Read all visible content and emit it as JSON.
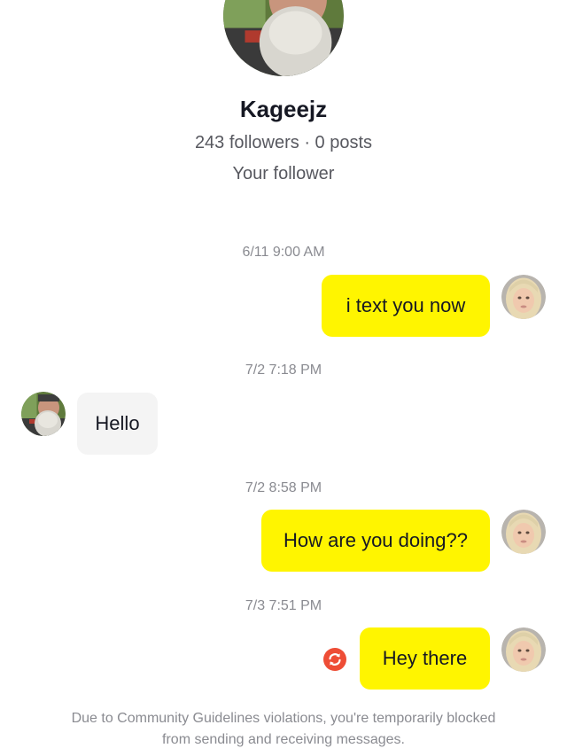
{
  "profile": {
    "name": "Kageejz",
    "stats": "243 followers · 0 posts",
    "relation": "Your follower",
    "avatar_icon": "profile-photo-bearded-man"
  },
  "messages": [
    {
      "timestamp": "6/11 9:00 AM",
      "direction": "outgoing",
      "text": "i text you now"
    },
    {
      "timestamp": "7/2 7:18 PM",
      "direction": "incoming",
      "text": "Hello"
    },
    {
      "timestamp": "7/2 8:58 PM",
      "direction": "outgoing",
      "text": "How are you doing??"
    },
    {
      "timestamp": "7/3 7:51 PM",
      "direction": "outgoing",
      "text": "Hey there",
      "status_icon": "resend-icon"
    }
  ],
  "notice": {
    "line1": "Due to Community Guidelines violations, you're temporarily blocked",
    "line2": "from sending and receiving messages."
  },
  "colors": {
    "outgoing_bubble": "#fff500",
    "incoming_bubble": "#f4f4f4",
    "resend_badge": "#ee4d36",
    "muted_text": "#8a8b91"
  }
}
